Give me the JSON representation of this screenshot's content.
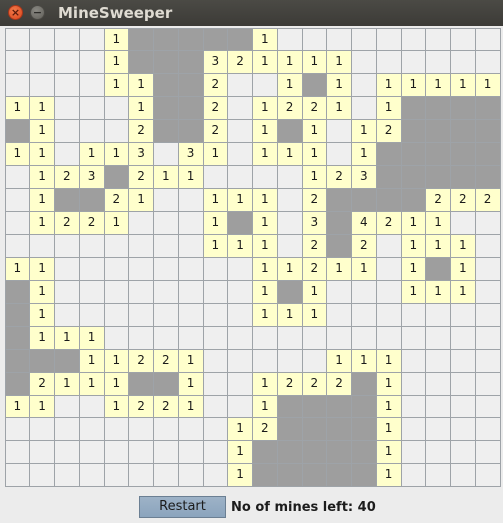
{
  "window": {
    "title": "MineSweeper",
    "close_glyph": "×",
    "minimize_glyph": "−"
  },
  "board": {
    "rows": 20,
    "cols": 20,
    "legend": {
      ".": "unopened cell",
      "0": "opened empty cell",
      "1-8": "adjacent mine count",
      "M": "revealed mine (gray)"
    },
    "grid": [
      ". . . . 1 M M M M M 1 . . . . . . . . .",
      ". . . . 1 M M M 3 2 1 1 1 1 . . . . . .",
      ". . . . 1 1 M M 2 . . 1 M 1 . 1 1 1 1 1",
      "1 1 . . . 1 M M 2 . 1 2 2 1 . 1 M M M M",
      "M 1 . . . 2 M M 2 . 1 M 1 . 1 2 M M M M",
      "1 1 . 1 1 3 . 3 1 . 1 1 1 . 1 M M M M M",
      ". 1 2 3 M 2 1 1 . . . . 1 2 3 M M M M M",
      ". 1 M M 2 1 . . 1 1 1 . 2 M M M M 2 2 2",
      ". 1 2 2 1 . . . 1 M 1 . 3 M 4 2 1 1 . .",
      ". . . . . . . . 1 1 1 . 2 M 2 . 1 1 1 .",
      "1 1 . . . . . . . . 1 1 2 1 1 . 1 M 1 .",
      "M 1 . . . . . . . . 1 M 1 . . . 1 1 1 .",
      "M 1 . . . . . . . . 1 1 1 . . . . . . .",
      "M 1 1 1 . . . . . . . . . . . . . . . .",
      "M M M 1 1 2 2 1 . . . . . 1 1 1 . . . .",
      "M 2 1 1 1 M M 1 . . 1 2 2 2 M 1 . . . .",
      "1 1 . . 1 2 2 1 . . 1 M M M M 1 . . . .",
      ". . . . . . . . . 1 2 M M M M 1 . . . .",
      ". . . . . . . . . 1 M M M M M 1 . . . .",
      ". . . . . . . . . 1 M M M M M 1 . . . ."
    ]
  },
  "footer": {
    "restart_label": "Restart",
    "mines_left_label": "No of mines left: 40",
    "mines_left": 40
  },
  "colors": {
    "unopened": "#efefef",
    "number": "#ffffcc",
    "mine": "#9e9e9e",
    "grid_line": "#9ea3a8",
    "titlebar": "#3c3b37",
    "restart_button": "#8ba4bd"
  }
}
